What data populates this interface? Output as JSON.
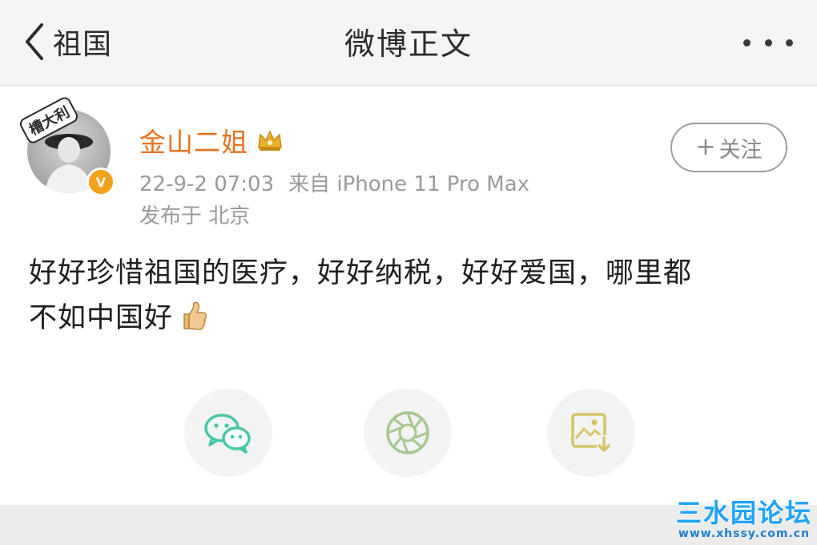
{
  "nav": {
    "back_label": "祖国",
    "title": "微博正文"
  },
  "post": {
    "avatar_sticker_text": "槽大利",
    "username": "金山二姐",
    "time": "22-9-2 07:03",
    "source": "来自 iPhone 11 Pro Max",
    "location": "发布于 北京",
    "follow_plus": "+",
    "follow_label": "关注",
    "text_line1": "好好珍惜祖国的医疗，好好纳税，好好爱国，哪里都",
    "text_line2": "不如中国好",
    "verified_badge": "V"
  },
  "share": {
    "icons": [
      "wechat-icon",
      "moments-icon",
      "save-image-icon"
    ]
  },
  "watermark": {
    "name": "三水园论坛",
    "url": "www.xhssy.com.cn"
  },
  "colors": {
    "username": "#e8731f",
    "meta": "#9a9a9a",
    "wechat": "#47c7a8",
    "moments": "#a6c78f",
    "save": "#d6c46a",
    "watermark": "#1fa3ff"
  }
}
